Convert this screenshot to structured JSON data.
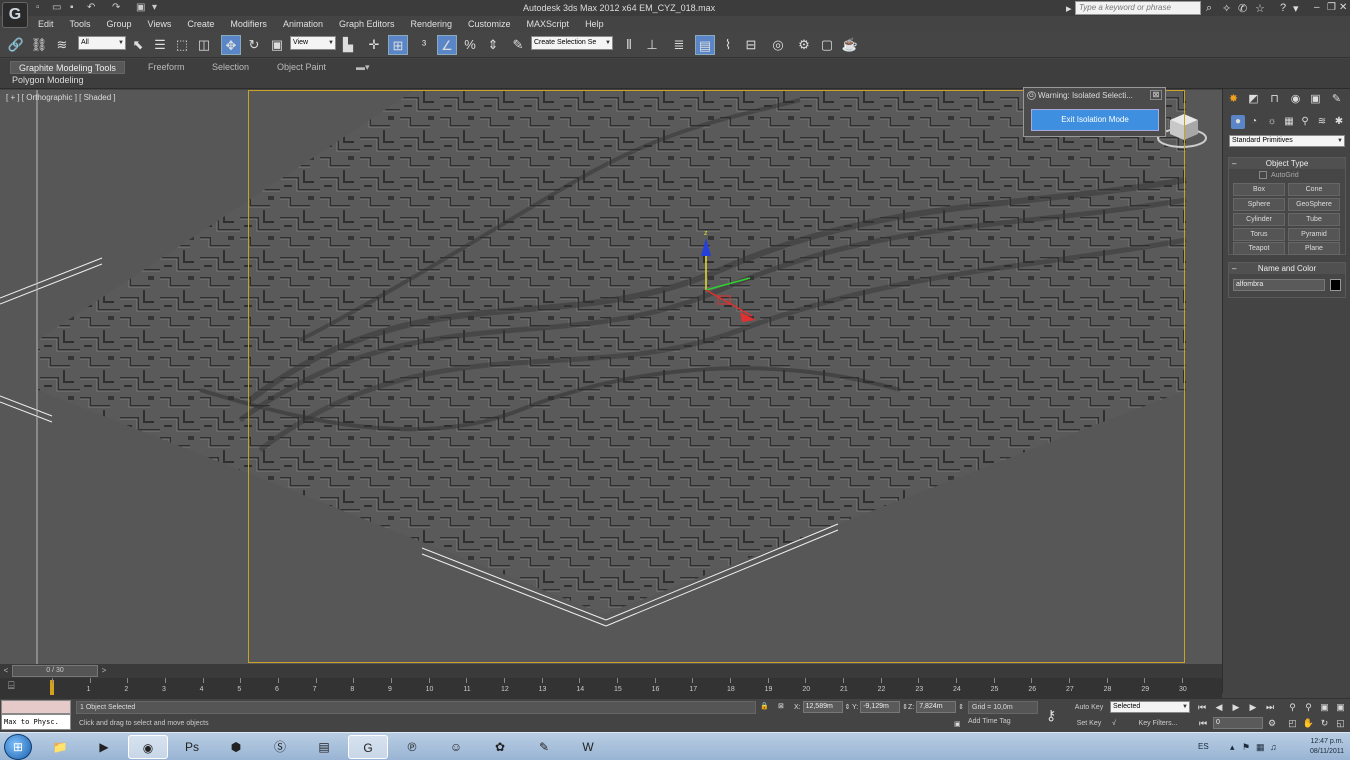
{
  "window": {
    "app_icon": "3ds-max-logo-icon",
    "title": "Autodesk 3ds Max  2012 x64     EM_CYZ_018.max",
    "search_placeholder": "Type a keyword or phrase"
  },
  "menu": [
    "Edit",
    "Tools",
    "Group",
    "Views",
    "Create",
    "Modifiers",
    "Animation",
    "Graph Editors",
    "Rendering",
    "Customize",
    "MAXScript",
    "Help"
  ],
  "toolbar": {
    "selection_filter": "All",
    "reference_coord": "View",
    "named_selection": "Create Selection Se"
  },
  "ribbon": {
    "tabs": [
      "Graphite Modeling Tools",
      "Freeform",
      "Selection",
      "Object Paint"
    ],
    "active_tab": "Graphite Modeling Tools",
    "subtab": "Polygon Modeling"
  },
  "viewport": {
    "label": "[ + ] [ Orthographic ] [ Shaded ]",
    "gizmo_axis_z": "z",
    "accent_color": "#c9a22a"
  },
  "warning_dialog": {
    "title": "Warning: Isolated Selecti...",
    "button": "Exit Isolation Mode",
    "close": "⊠"
  },
  "command_panel": {
    "category_dropdown": "Standard Primitives",
    "object_type": {
      "header": "Object Type",
      "autogrid": "AutoGrid",
      "buttons": [
        "Box",
        "Cone",
        "Sphere",
        "GeoSphere",
        "Cylinder",
        "Tube",
        "Torus",
        "Pyramid",
        "Teapot",
        "Plane"
      ]
    },
    "name_and_color": {
      "header": "Name and Color",
      "name": "alfombra",
      "color": "#000000"
    }
  },
  "time_slider": {
    "position": "0 / 30",
    "prev": "<",
    "next": ">"
  },
  "trackbar": {
    "ticks": [
      "0",
      "1",
      "2",
      "3",
      "4",
      "5",
      "6",
      "7",
      "8",
      "9",
      "10",
      "11",
      "12",
      "13",
      "14",
      "15",
      "16",
      "17",
      "18",
      "19",
      "20",
      "21",
      "22",
      "23",
      "24",
      "25",
      "26",
      "27",
      "28",
      "29",
      "30"
    ]
  },
  "status": {
    "maxscript_listener": "Max to Physc.",
    "selection_info": "1 Object Selected",
    "prompt": "Click and drag to select and move objects",
    "x_label": "X:",
    "x_value": "12,589m",
    "y_label": "Y:",
    "y_value": "-9,129m",
    "z_label": "Z:",
    "z_value": "7,824m",
    "grid": "Grid = 10,0m",
    "add_time_tag": "Add Time Tag",
    "auto_key": "Auto Key",
    "set_key": "Set Key",
    "key_mode_dropdown": "Selected",
    "key_filters": "Key Filters...",
    "current_frame": "0"
  },
  "taskbar": {
    "language": "ES",
    "time": "12:47 p.m.",
    "date": "08/11/2011"
  }
}
